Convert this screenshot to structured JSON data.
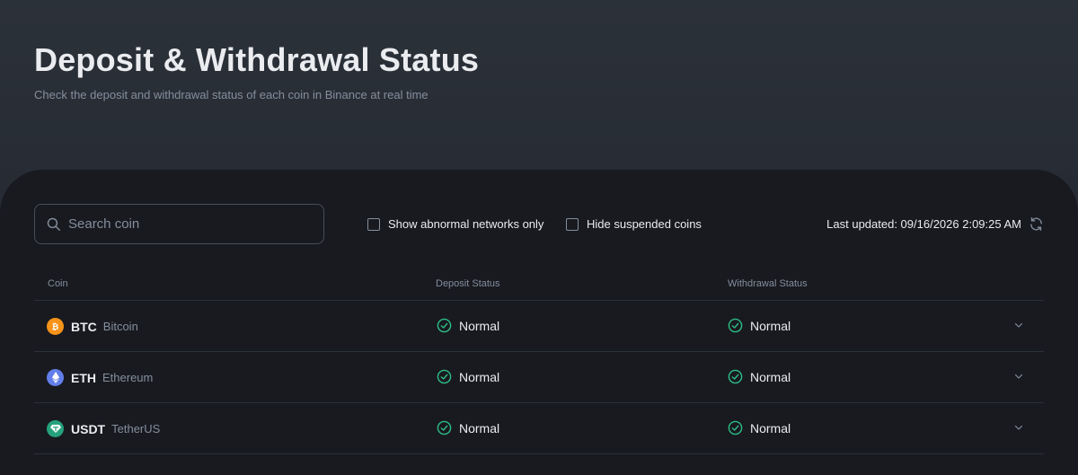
{
  "header": {
    "title": "Deposit & Withdrawal Status",
    "subtitle": "Check the deposit and withdrawal status of each coin in Binance at real time"
  },
  "search": {
    "placeholder": "Search coin",
    "value": "",
    "icon": "search-icon"
  },
  "filters": {
    "abnormal_label": "Show abnormal networks only",
    "abnormal_checked": false,
    "suspended_label": "Hide suspended coins",
    "suspended_checked": false
  },
  "last_updated": {
    "text": "Last updated: 09/16/2026 2:09:25 AM",
    "icon": "refresh-icon"
  },
  "table": {
    "columns": [
      "Coin",
      "Deposit Status",
      "Withdrawal Status"
    ],
    "rows": [
      {
        "symbol": "BTC",
        "name": "Bitcoin",
        "icon": "bitcoin-icon",
        "icon_color": "#f7931a",
        "deposit": "Normal",
        "withdrawal": "Normal"
      },
      {
        "symbol": "ETH",
        "name": "Ethereum",
        "icon": "ethereum-icon",
        "icon_color": "#627eea",
        "deposit": "Normal",
        "withdrawal": "Normal"
      },
      {
        "symbol": "USDT",
        "name": "TetherUS",
        "icon": "tether-icon",
        "icon_color": "#26a17b",
        "deposit": "Normal",
        "withdrawal": "Normal"
      }
    ]
  },
  "colors": {
    "background": "#181a20",
    "hero": "#2b3139",
    "status_ok": "#2ebd85",
    "muted_text": "#848e9c"
  }
}
